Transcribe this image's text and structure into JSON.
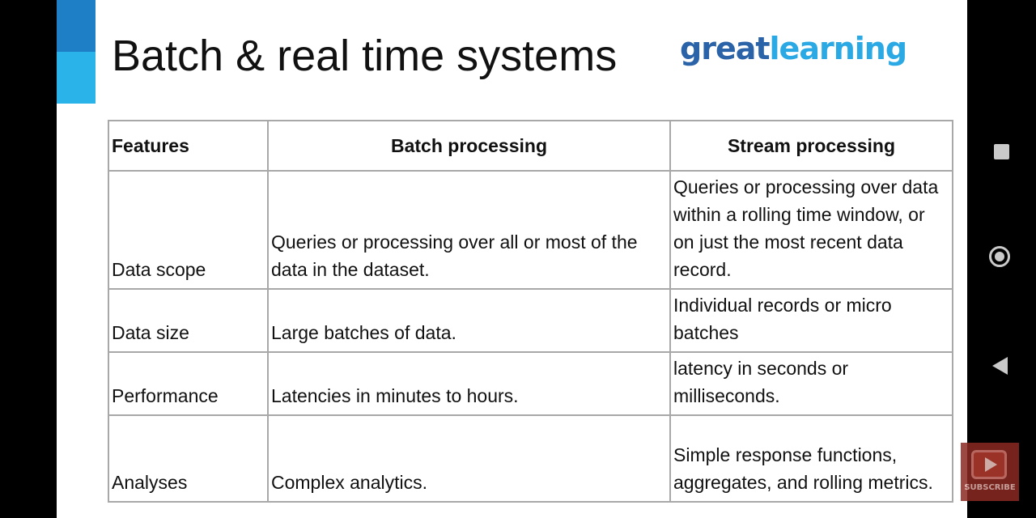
{
  "slide": {
    "title": "Batch & real time systems",
    "logo": {
      "part_a": "great",
      "part_b": "learning"
    }
  },
  "table": {
    "headers": [
      "Features",
      "Batch processing",
      "Stream processing"
    ],
    "rows": [
      [
        "Data scope",
        "Queries or processing over all or most of the data in the dataset.",
        "Queries or processing over data within a rolling time window, or on just the most recent data record."
      ],
      [
        "Data size",
        "Large batches of data.",
        "Individual records or micro batches"
      ],
      [
        "Performance",
        "Latencies in minutes to hours.",
        "latency in seconds or milliseconds."
      ],
      [
        "Analyses",
        "Complex analytics.",
        "Simple response functions, aggregates, and rolling metrics."
      ]
    ]
  },
  "overlay": {
    "subscribe_label": "SUBSCRIBE"
  },
  "icons": [
    "recent-apps-icon",
    "home-icon",
    "back-icon",
    "play-icon"
  ],
  "colors": {
    "accent_dark": "#1e7fc7",
    "accent_light": "#2ab3e8",
    "logo_dark": "#2b63a8",
    "logo_light": "#2aa9e4"
  }
}
